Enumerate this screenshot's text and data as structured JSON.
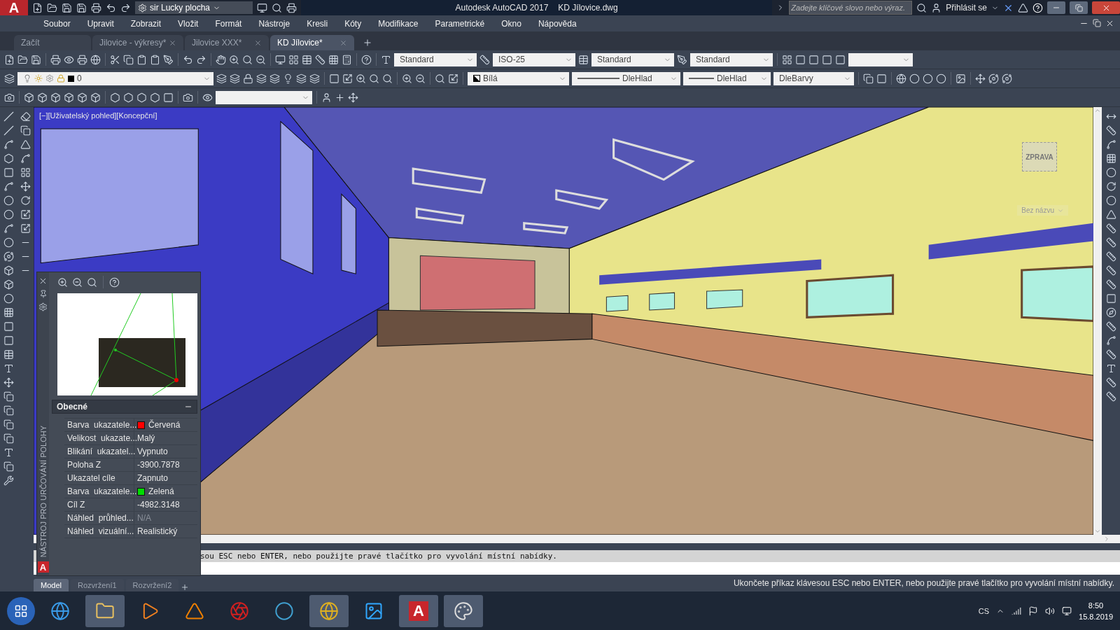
{
  "title_bar": {
    "logo": "A",
    "workspace": "sir Lucky plocha",
    "title": "Autodesk AutoCAD 2017",
    "document": "KD Jílovice.dwg",
    "search": {
      "placeholder": "Zadejte klíčové slovo nebo výraz."
    },
    "sign_in": "Přihlásit se"
  },
  "menu": [
    "Soubor",
    "Upravit",
    "Zobrazit",
    "Vložit",
    "Formát",
    "Nástroje",
    "Kresli",
    "Kóty",
    "Modifikace",
    "Parametrické",
    "Okno",
    "Nápověda"
  ],
  "doc_tabs": [
    {
      "label": "Začít",
      "selected": false,
      "closable": false
    },
    {
      "label": "Jilovice - výkresy*",
      "selected": false,
      "closable": true
    },
    {
      "label": "Jilovice XXX*",
      "selected": false,
      "closable": true
    },
    {
      "label": "KD Jílovice*",
      "selected": true,
      "closable": true
    }
  ],
  "toolbar_styles": {
    "text_style": "Standard",
    "dim_style": "ISO-25",
    "table_style": "Standard",
    "mleader_style": "Standard"
  },
  "toolbar_properties": {
    "layer": "0",
    "color_name": "Bílá",
    "linetype": "DleHlad",
    "lineweight": "DleHlad",
    "plot_style": "DleBarvy"
  },
  "viewport": {
    "label": "[−][Uživatelský pohled][Koncepční]",
    "viewcube_face": "ZPRAVA",
    "ucs": "Bez názvu"
  },
  "position_panel": {
    "logo": "A",
    "title": "NÁSTROJ PRO URČOVÁNÍ POLOHY",
    "section": "Obecné",
    "section_expanded": true,
    "properties": [
      {
        "name": "Barva  ukazatele...",
        "value": "Červená",
        "color": "#ff0000",
        "disabled": false
      },
      {
        "name": "Velikost  ukazate...",
        "value": "Malý",
        "disabled": false
      },
      {
        "name": "Blikání  ukazatel...",
        "value": "Vypnuto",
        "disabled": false
      },
      {
        "name": "Poloha Z",
        "value": "-3900.7878",
        "disabled": false
      },
      {
        "name": "Ukazatel cíle",
        "value": "Zapnuto",
        "disabled": false
      },
      {
        "name": "Barva  ukazatele...",
        "value": "Zelená",
        "color": "#00dd00",
        "disabled": false
      },
      {
        "name": "Cíl Z",
        "value": "-4982.3148",
        "disabled": false
      },
      {
        "name": "Náhled  průhled...",
        "value": "N/A",
        "disabled": true
      },
      {
        "name": "Náhled  vizuální...",
        "value": "Realistický",
        "disabled": false
      }
    ]
  },
  "command_line": {
    "history": "sou ESC nebo ENTER, nebo použijte pravé tlačítko pro vyvolání místní nabídky."
  },
  "layout_tabs": [
    {
      "label": "Model",
      "selected": true
    },
    {
      "label": "Rozvržení1",
      "selected": false
    },
    {
      "label": "Rozvržení2",
      "selected": false
    }
  ],
  "status_message": "Ukončete příkaz klávesou ESC nebo ENTER, nebo použijte pravé tlačítko pro vyvolání místní nabídky.",
  "taskbar": {
    "autocad_logo": "A",
    "language": "CS",
    "time": "8:50",
    "date": "15.8.2019"
  }
}
